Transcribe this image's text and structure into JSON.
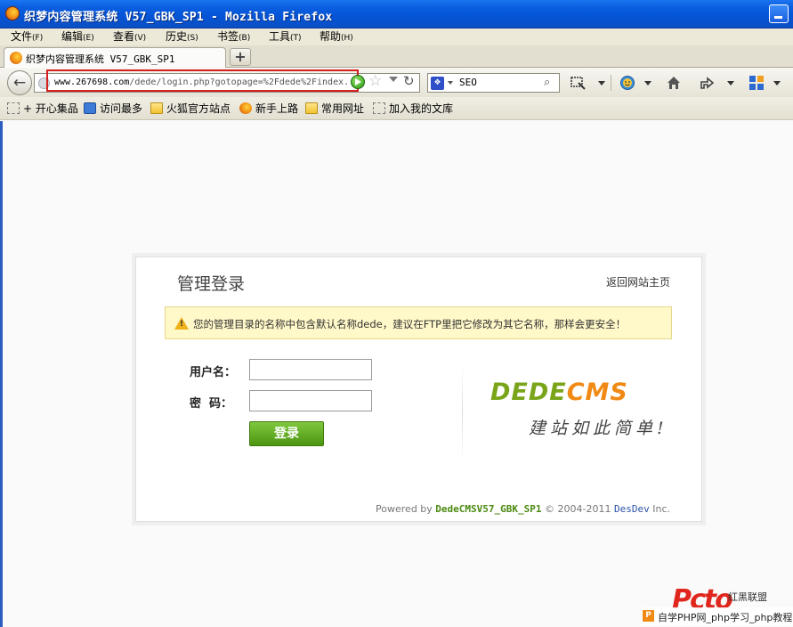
{
  "window": {
    "title": "织梦内容管理系统 V57_GBK_SP1 - Mozilla Firefox"
  },
  "menu": [
    {
      "label": "文件",
      "key": "(F)"
    },
    {
      "label": "编辑",
      "key": "(E)"
    },
    {
      "label": "查看",
      "key": "(V)"
    },
    {
      "label": "历史",
      "key": "(S)"
    },
    {
      "label": "书签",
      "key": "(B)"
    },
    {
      "label": "工具",
      "key": "(T)"
    },
    {
      "label": "帮助",
      "key": "(H)"
    }
  ],
  "tabs": {
    "active": "织梦内容管理系统 V57_GBK_SP1",
    "new_tab": "+"
  },
  "nav": {
    "url_host": "www.267698.com",
    "url_rest": "/dede/login.php?gotopage=%2Fdede%2Findex.",
    "search_value": "SEO"
  },
  "bookmarks": [
    "+ 开心集品",
    "访问最多",
    "火狐官方站点",
    "新手上路",
    "常用网址",
    "加入我的文库"
  ],
  "login": {
    "title": "管理登录",
    "back_home": "返回网站主页",
    "warning": "您的管理目录的名称中包含默认名称dede，建议在FTP里把它修改为其它名称，那样会更安全！",
    "username_label": "用户名：",
    "password_label": "密  码：",
    "submit": "登录",
    "brand_a": "DEDE",
    "brand_b": "CMS",
    "slogan": "建站如此简单!",
    "powered_prefix": "Powered by",
    "powered_version": "DedeCMSV57_GBK_SP1",
    "powered_copy": "© 2004-2011",
    "powered_company": "DesDev",
    "powered_suffix": "Inc."
  },
  "watermark": {
    "logo": "Pcto",
    "sub": "红黑联盟",
    "bar": "自学PHP网_php学习_php教程"
  }
}
